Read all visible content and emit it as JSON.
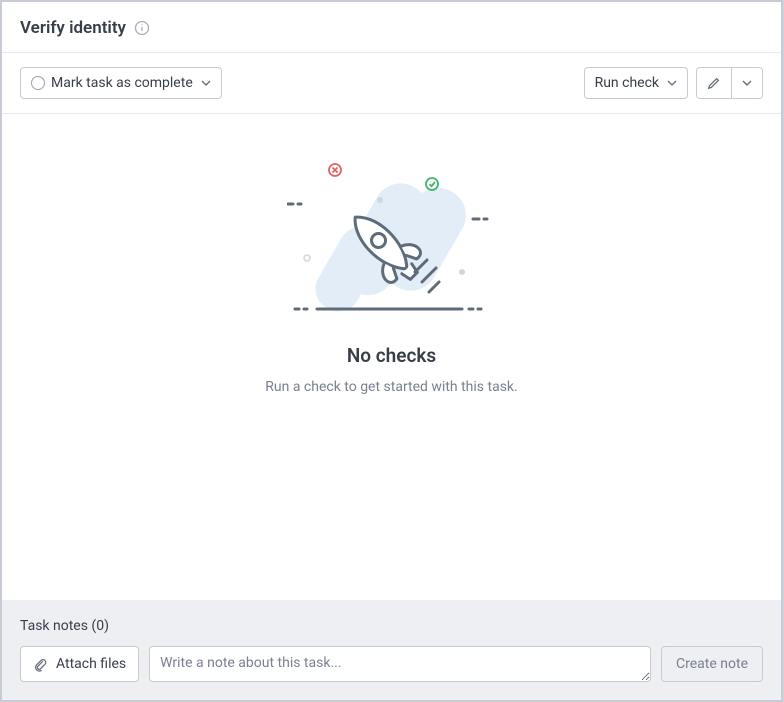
{
  "header": {
    "title": "Verify identity"
  },
  "toolbar": {
    "mark_complete_label": "Mark task as complete",
    "run_check_label": "Run check"
  },
  "empty_state": {
    "title": "No checks",
    "subtitle": "Run a check to get started with this task."
  },
  "notes": {
    "title": "Task notes (0)",
    "attach_label": "Attach files",
    "placeholder": "Write a note about this task...",
    "create_label": "Create note"
  }
}
